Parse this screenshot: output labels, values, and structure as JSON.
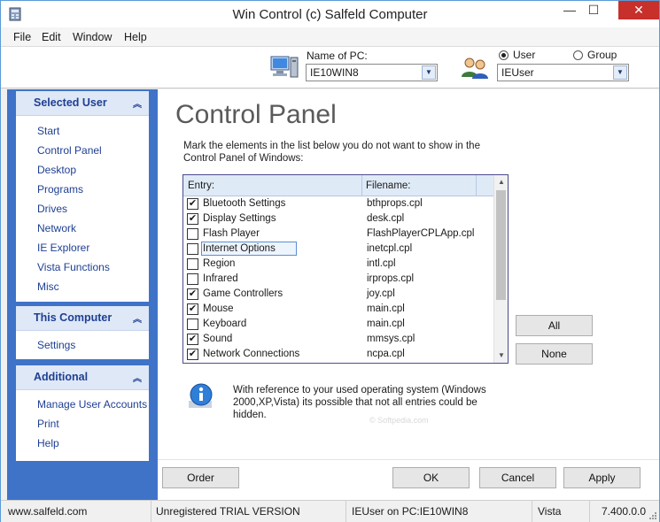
{
  "window": {
    "title": "Win Control (c) Salfeld Computer",
    "min": "—",
    "max": "☐",
    "close": "✕"
  },
  "menu": [
    "File",
    "Edit",
    "Window",
    "Help"
  ],
  "top": {
    "pc_label": "Name of PC:",
    "pc_value": "IE10WIN8",
    "radio_user": "User",
    "radio_group": "Group",
    "user_value": "IEUser"
  },
  "sidebar": {
    "selected_user": {
      "title": "Selected User",
      "items": [
        "Start",
        "Control Panel",
        "Desktop",
        "Programs",
        "Drives",
        "Network",
        "IE Explorer",
        "Vista Functions",
        "Misc"
      ]
    },
    "this_computer": {
      "title": "This Computer",
      "items": [
        "Settings"
      ]
    },
    "additional": {
      "title": "Additional",
      "items": [
        "Manage User Accounts",
        "Print",
        "Help"
      ]
    }
  },
  "main": {
    "title": "Control Panel",
    "description": "Mark the elements in the list below you do not want to show in the Control Panel of Windows:",
    "columns": [
      "Entry:",
      "Filename:"
    ],
    "rows": [
      {
        "entry": "Bluetooth Settings",
        "file": "bthprops.cpl",
        "checked": true
      },
      {
        "entry": "Display Settings",
        "file": "desk.cpl",
        "checked": true
      },
      {
        "entry": "Flash Player",
        "file": "FlashPlayerCPLApp.cpl",
        "checked": false
      },
      {
        "entry": "Internet Options",
        "file": "inetcpl.cpl",
        "checked": false
      },
      {
        "entry": "Region",
        "file": "intl.cpl",
        "checked": false
      },
      {
        "entry": "Infrared",
        "file": "irprops.cpl",
        "checked": false
      },
      {
        "entry": "Game Controllers",
        "file": "joy.cpl",
        "checked": true
      },
      {
        "entry": "Mouse",
        "file": "main.cpl",
        "checked": true
      },
      {
        "entry": "Keyboard",
        "file": "main.cpl",
        "checked": false
      },
      {
        "entry": "Sound",
        "file": "mmsys.cpl",
        "checked": true
      },
      {
        "entry": "Network Connections",
        "file": "ncpa.cpl",
        "checked": true
      }
    ],
    "btn_all": "All",
    "btn_none": "None",
    "info": "With reference to your used operating system (Windows 2000,XP,Vista) its possible that not all entries could be hidden.",
    "watermark": "© Softpedia.com"
  },
  "footer": {
    "order": "Order",
    "ok": "OK",
    "cancel": "Cancel",
    "apply": "Apply"
  },
  "status": {
    "site": "www.salfeld.com",
    "license": "Unregistered TRIAL VERSION",
    "userpc": "IEUser on PC:IE10WIN8",
    "os": "Vista",
    "version": "7.400.0.0"
  },
  "colors": {
    "sidebar": "#3f73c8",
    "group_title": "#1e3f92",
    "close": "#c7302b"
  }
}
